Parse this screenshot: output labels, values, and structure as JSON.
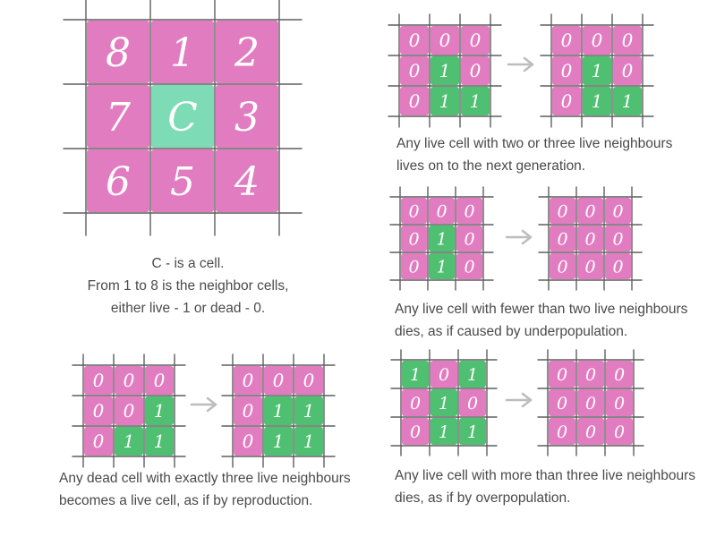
{
  "colors": {
    "dead_cell": "#e27cc0",
    "live_cell": "#4fbf71",
    "center_cell": "#7ddbb6",
    "grid_line": "#5f5f5f",
    "digit": "#ffffff",
    "arrow": "#bdbdbd",
    "caption": "#4a4a4a"
  },
  "legend": {
    "cells": [
      "8",
      "1",
      "2",
      "7",
      "C",
      "3",
      "6",
      "5",
      "4"
    ],
    "caption": [
      "C - is a cell.",
      "From 1 to 8 is the neighbor cells,",
      "either live - 1 or dead - 0."
    ]
  },
  "rules": [
    {
      "id": "survival",
      "before": [
        "0",
        "0",
        "0",
        "0",
        "1",
        "0",
        "0",
        "1",
        "1"
      ],
      "after": [
        "0",
        "0",
        "0",
        "0",
        "1",
        "0",
        "0",
        "1",
        "1"
      ],
      "caption": [
        "Any live cell with two or three live neighbours",
        "lives on to the next generation."
      ]
    },
    {
      "id": "underpopulation",
      "before": [
        "0",
        "0",
        "0",
        "0",
        "1",
        "0",
        "0",
        "1",
        "0"
      ],
      "after": [
        "0",
        "0",
        "0",
        "0",
        "0",
        "0",
        "0",
        "0",
        "0"
      ],
      "caption": [
        "Any live cell with fewer than two live neighbours",
        "dies, as if caused by underpopulation."
      ]
    },
    {
      "id": "reproduction",
      "before": [
        "0",
        "0",
        "0",
        "0",
        "0",
        "1",
        "0",
        "1",
        "1"
      ],
      "after": [
        "0",
        "0",
        "0",
        "0",
        "1",
        "1",
        "0",
        "1",
        "1"
      ],
      "caption": [
        "Any dead cell with exactly three live neighbours",
        "becomes a live cell, as if by reproduction."
      ]
    },
    {
      "id": "overpopulation",
      "before": [
        "1",
        "0",
        "1",
        "0",
        "1",
        "0",
        "0",
        "1",
        "1"
      ],
      "after": [
        "0",
        "0",
        "0",
        "0",
        "0",
        "0",
        "0",
        "0",
        "0"
      ],
      "caption": [
        "Any live cell with more than three live neighbours",
        "dies, as if by overpopulation."
      ]
    }
  ]
}
